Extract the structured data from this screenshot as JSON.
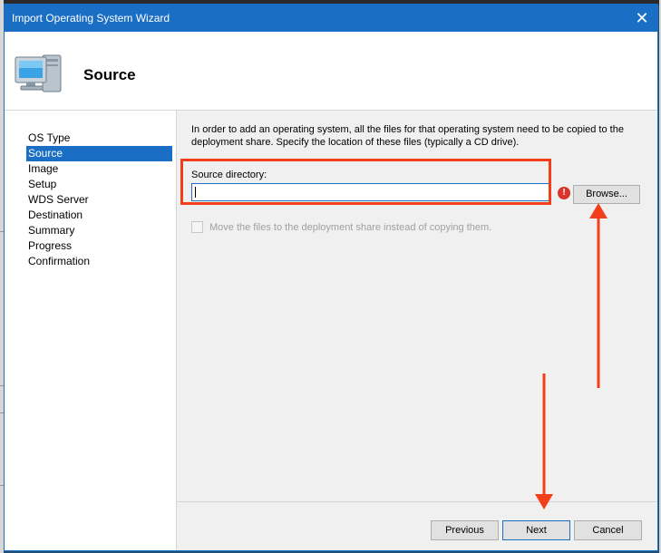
{
  "window": {
    "title": "Import Operating System Wizard",
    "close_glyph": "✕"
  },
  "header": {
    "title": "Source",
    "icon": "computer-icon"
  },
  "nav": {
    "items": [
      {
        "label": "OS Type"
      },
      {
        "label": "Source"
      },
      {
        "label": "Image"
      },
      {
        "label": "Setup"
      },
      {
        "label": "WDS Server"
      },
      {
        "label": "Destination"
      },
      {
        "label": "Summary"
      },
      {
        "label": "Progress"
      },
      {
        "label": "Confirmation"
      }
    ],
    "active": "Source"
  },
  "content": {
    "intro": "In order to add an operating system, all the files for that operating system need to be copied to the deployment share.  Specify the location of these files (typically a CD drive).",
    "source_label": "Source directory:",
    "source_value": "",
    "error_glyph": "!",
    "browse_label": "Browse...",
    "move_files_label": "Move the files to the deployment share instead of copying them.",
    "move_files_checked": false
  },
  "footer": {
    "previous_label": "Previous",
    "next_label": "Next",
    "cancel_label": "Cancel"
  },
  "colors": {
    "accent": "#1a6fc4",
    "annotation": "#f23e1b",
    "error": "#d9352b"
  }
}
